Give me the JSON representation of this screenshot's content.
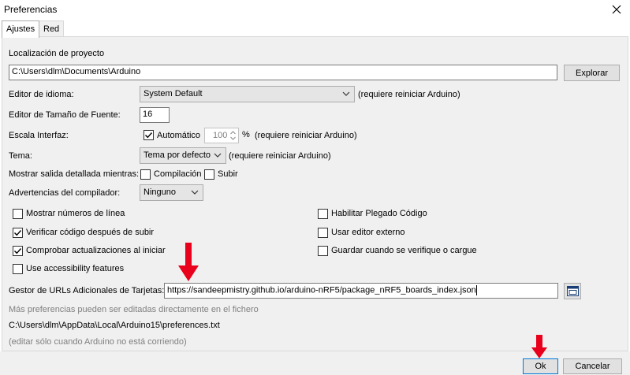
{
  "window": {
    "title": "Preferencias"
  },
  "tabs": [
    {
      "label": "Ajustes",
      "active": true
    },
    {
      "label": "Red",
      "active": false
    }
  ],
  "sketchbook": {
    "label": "Localización de proyecto",
    "path": "C:\\Users\\dlm\\Documents\\Arduino",
    "browse_label": "Explorar"
  },
  "language": {
    "label": "Editor de idioma:",
    "value": "System Default",
    "note": "(requiere reiniciar Arduino)"
  },
  "font_size": {
    "label": "Editor de Tamaño de Fuente:",
    "value": "16"
  },
  "scale": {
    "label": "Escala Interfaz:",
    "auto_label": "Automático",
    "auto_checked": true,
    "value": "100",
    "unit": "%",
    "note": "(requiere reiniciar Arduino)"
  },
  "theme": {
    "label": "Tema:",
    "value": "Tema por defecto",
    "note": "(requiere reiniciar Arduino)"
  },
  "verbose": {
    "label": "Mostrar salida detallada mientras:",
    "compile_label": "Compilación",
    "compile_checked": false,
    "upload_label": "Subir",
    "upload_checked": false
  },
  "warnings": {
    "label": "Advertencias del compilador:",
    "value": "Ninguno"
  },
  "options_left": [
    {
      "label": "Mostrar números de línea",
      "checked": false
    },
    {
      "label": "Verificar código después de subir",
      "checked": true
    },
    {
      "label": "Comprobar actualizaciones al iniciar",
      "checked": true
    },
    {
      "label": "Use accessibility features",
      "checked": false
    }
  ],
  "options_right": [
    {
      "label": "Habilitar Plegado Código",
      "checked": false
    },
    {
      "label": "Usar editor externo",
      "checked": false
    },
    {
      "label": "Guardar cuando se verifique o cargue",
      "checked": false
    }
  ],
  "board_urls": {
    "label": "Gestor de URLs Adicionales de Tarjetas:",
    "value": "https://sandeepmistry.github.io/arduino-nRF5/package_nRF5_boards_index.json"
  },
  "footer": {
    "more_prefs": "Más preferencias pueden ser editadas directamente en el fichero",
    "prefs_path": "C:\\Users\\dlm\\AppData\\Local\\Arduino15\\preferences.txt",
    "edit_note": "(editar sólo cuando Arduino no está corriendo)"
  },
  "actions": {
    "ok_label": "Ok",
    "cancel_label": "Cancelar"
  },
  "colors": {
    "annotation_arrow": "#e8001c",
    "checkmark": "#000000",
    "panel": "#f0f0f0"
  }
}
